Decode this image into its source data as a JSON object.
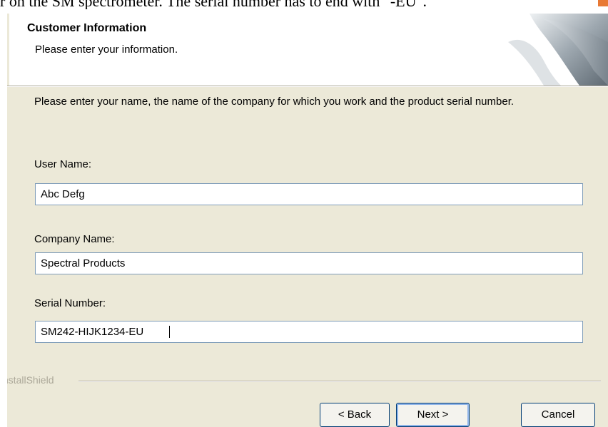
{
  "page_caption": "r on the SM spectrometer. The serial number has to end with \"-EU\".",
  "header": {
    "title": "Customer Information",
    "subtitle": "Please enter your information."
  },
  "instructions": "Please enter your name, the name of the company for which you work and the product serial number.",
  "fields": {
    "user_name": {
      "label": "User Name:",
      "value": "Abc Defg"
    },
    "company_name": {
      "label": "Company Name:",
      "value": "Spectral Products"
    },
    "serial_number": {
      "label": "Serial Number:",
      "value": "SM242-HIJK1234-EU"
    }
  },
  "branding": {
    "label": "InstallShield"
  },
  "buttons": {
    "back": "< Back",
    "next": "Next >",
    "cancel": "Cancel"
  },
  "colors": {
    "dialog_background": "#ece9d8",
    "header_background": "#ffffff",
    "input_border": "#7f9db9",
    "button_border": "#003c74"
  }
}
